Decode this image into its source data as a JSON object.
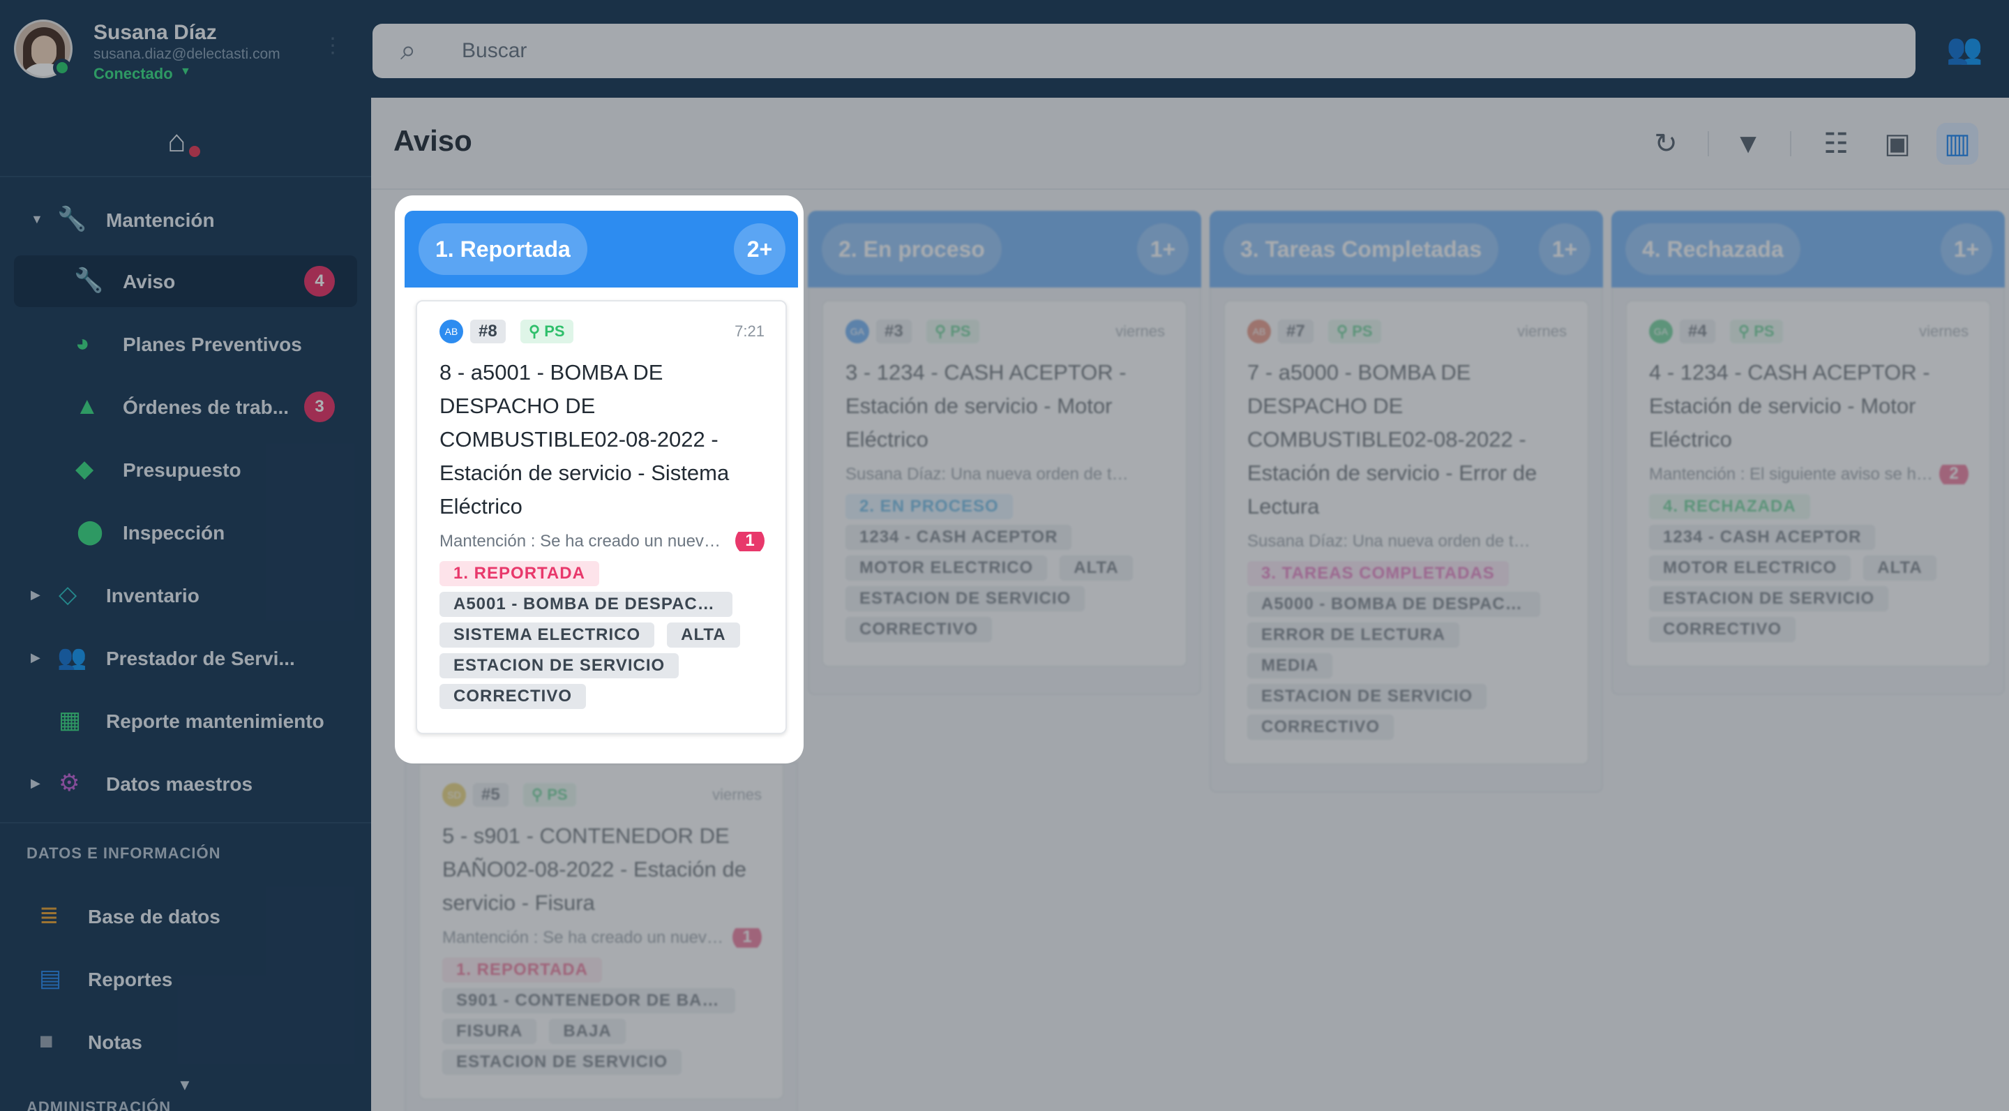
{
  "user": {
    "name": "Susana Díaz",
    "email": "susana.diaz@delectasti.com",
    "status": "Conectado"
  },
  "search": {
    "placeholder": "Buscar"
  },
  "page": {
    "title": "Aviso"
  },
  "sidebar": {
    "items": [
      {
        "label": "Mantención",
        "icon": "wrench-icon",
        "color": "#3ddc84"
      },
      {
        "label": "Aviso",
        "icon": "wrench-icon",
        "color": "#3ddc84",
        "badge": "4"
      },
      {
        "label": "Planes Preventivos",
        "icon": "planes-icon",
        "color": "#3ddc84"
      },
      {
        "label": "Órdenes de trab...",
        "icon": "briefcase-icon",
        "color": "#3ddc84",
        "badge": "3"
      },
      {
        "label": "Presupuesto",
        "icon": "tag-icon",
        "color": "#3ddc84"
      },
      {
        "label": "Inspección",
        "icon": "map-pin-icon",
        "color": "#3ddc84"
      },
      {
        "label": "Inventario",
        "icon": "diamond-icon",
        "color": "#2ec4c4"
      },
      {
        "label": "Prestador de Servi...",
        "icon": "group-icon",
        "color": "#e0666b"
      },
      {
        "label": "Reporte mantenimiento",
        "icon": "grid-icon",
        "color": "#3ddc84"
      },
      {
        "label": "Datos maestros",
        "icon": "gear-icon",
        "color": "#c266d6"
      }
    ],
    "section_data": "DATOS E INFORMACIÓN",
    "data_items": [
      {
        "label": "Base de datos",
        "icon": "database-icon",
        "color": "#e6a43a"
      },
      {
        "label": "Reportes",
        "icon": "report-icon",
        "color": "#2d8cf0"
      },
      {
        "label": "Notas",
        "icon": "folder-icon",
        "color": "#9aa7b4"
      }
    ],
    "section_admin": "ADMINISTRACIÓN"
  },
  "columns": [
    {
      "title": "1. Reportada",
      "count": "2+",
      "cards": [
        {
          "avatar": "AB",
          "avatar_color": "#2d8cf0",
          "number": "#8",
          "ps": "PS",
          "time": "7:21",
          "title": "8 - a5001 - BOMBA DE DESPACHO DE COMBUSTIBLE02-08-2022 - Estación de servicio - Sistema Eléctrico",
          "message": "Mantención : Se ha creado un nuevo aviso",
          "badge": "1",
          "status": "1. REPORTADA",
          "tags": [
            "A5001 - BOMBA DE DESPACHO DE COMBUSTIBLE",
            "SISTEMA ELECTRICO",
            "ALTA",
            "ESTACION DE SERVICIO",
            "CORRECTIVO"
          ]
        },
        {
          "avatar": "SD",
          "avatar_color": "#e6c23a",
          "number": "#5",
          "ps": "PS",
          "time": "viernes",
          "title": "5 - s901 - CONTENEDOR DE BAÑO02-08-2022 - Estación de servicio - Fisura",
          "message": "Mantención : Se ha creado un nuevo aviso",
          "badge": "1",
          "status": "1. REPORTADA",
          "tags": [
            "S901 - CONTENEDOR DE BAÑO",
            "FISURA",
            "BAJA",
            "ESTACION DE SERVICIO"
          ]
        }
      ]
    },
    {
      "title": "2. En proceso",
      "count": "1+",
      "cards": [
        {
          "avatar": "GA",
          "avatar_color": "#2d8cf0",
          "number": "#3",
          "ps": "PS",
          "time": "viernes",
          "title": "3 - 1234 - CASH ACEPTOR - Estación de servicio - Motor Eléctrico",
          "message": "Susana Díaz: Una nueva orden de trabajo",
          "badge": "",
          "status": "2. EN PROCESO",
          "tags": [
            "1234 - CASH ACEPTOR",
            "MOTOR ELECTRICO",
            "ALTA",
            "ESTACION DE SERVICIO",
            "CORRECTIVO"
          ]
        }
      ]
    },
    {
      "title": "3. Tareas Completadas",
      "count": "1+",
      "cards": [
        {
          "avatar": "AB",
          "avatar_color": "#e0664a",
          "number": "#7",
          "ps": "PS",
          "time": "viernes",
          "title": "7 - a5000 - BOMBA DE DESPACHO DE COMBUSTIBLE02-08-2022 - Estación de servicio - Error de Lectura",
          "message": "Susana Díaz: Una nueva orden de trabajo",
          "badge": "",
          "status": "3. TAREAS COMPLETADAS",
          "tags": [
            "A5000 - BOMBA DE DESPACHO DE COMBUSTIBLE",
            "ERROR DE LECTURA",
            "MEDIA",
            "ESTACION DE SERVICIO",
            "CORRECTIVO"
          ]
        }
      ]
    },
    {
      "title": "4. Rechazada",
      "count": "1+",
      "cards": [
        {
          "avatar": "GA",
          "avatar_color": "#2fbf6b",
          "number": "#4",
          "ps": "PS",
          "time": "viernes",
          "title": "4 - 1234 - CASH ACEPTOR - Estación de servicio - Motor Eléctrico",
          "message": "Mantención : El siguiente aviso se ha rechazado",
          "badge": "2",
          "status": "4. RECHAZADA",
          "tags": [
            "1234 - CASH ACEPTOR",
            "MOTOR ELECTRICO",
            "ALTA",
            "ESTACION DE SERVICIO",
            "CORRECTIVO"
          ]
        }
      ]
    }
  ]
}
